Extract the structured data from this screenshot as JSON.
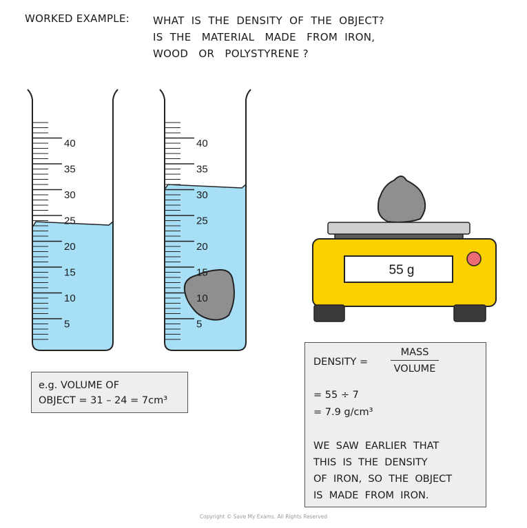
{
  "header": {
    "title": "WORKED  EXAMPLE:",
    "question_lines": [
      "WHAT  IS  THE  DENSITY  OF  THE  OBJECT?",
      "IS  THE   MATERIAL   MADE   FROM  IRON,",
      "WOOD   OR   POLYSTYRENE ?"
    ]
  },
  "cylinder_scale": [
    "40",
    "35",
    "30",
    "25",
    "20",
    "15",
    "10",
    "5"
  ],
  "colors": {
    "water": "#a7dff7",
    "balance": "#fdd000",
    "rock": "#9a9a9a",
    "button": "#ef6b73"
  },
  "icons": [
    "measuring-cylinder-icon",
    "rock-icon",
    "balance-scale-icon"
  ],
  "balance": {
    "reading": "55 g"
  },
  "volume_box": {
    "line1": "e.g.  VOLUME  OF",
    "line2": "OBJECT  =  31 – 24  = 7cm³"
  },
  "density_box": {
    "label": "DENSITY  =",
    "numerator": "MASS",
    "denominator": "VOLUME",
    "step1": "= 55 ÷ 7",
    "step2": "= 7.9  g/cm³",
    "conclusion": [
      "WE  SAW  EARLIER  THAT",
      "THIS  IS  THE  DENSITY",
      "OF  IRON,  SO  THE  OBJECT",
      "IS  MADE  FROM  IRON."
    ]
  },
  "copyright": "Copyright © Save My Exams. All Rights Reserved"
}
